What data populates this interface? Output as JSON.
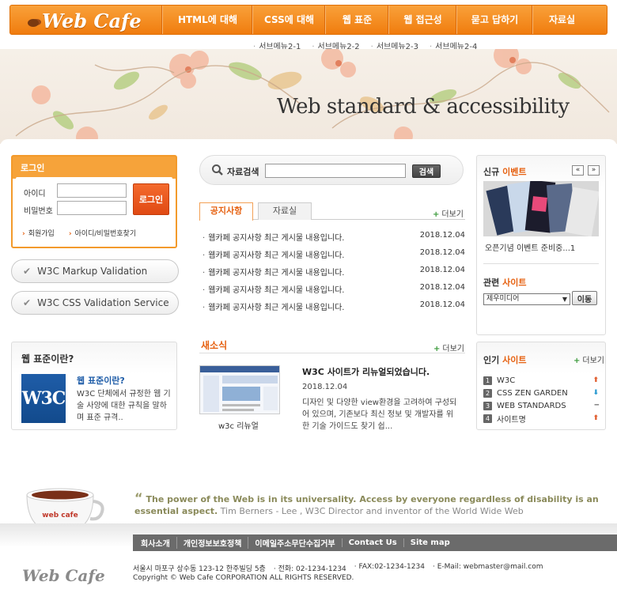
{
  "header": {
    "logo": "Web Cafe",
    "nav": [
      "HTML에 대해",
      "CSS에 대해",
      "웹 표준",
      "웹 접근성",
      "묻고 답하기",
      "자료실"
    ],
    "submenu": [
      "서브메뉴2-1",
      "서브메뉴2-2",
      "서브메뉴2-3",
      "서브메뉴2-4"
    ]
  },
  "banner": {
    "text": "Web standard & accessibility"
  },
  "login": {
    "title": "로그인",
    "id_label": "아이디",
    "pw_label": "비밀번호",
    "button": "로그인",
    "join_link": "회원가입",
    "find_link": "아이디/비밀번호찾기"
  },
  "validation": {
    "markup": "W3C Markup Validation",
    "css": "W3C CSS Validation Service"
  },
  "search": {
    "label": "자료검색",
    "button": "검색"
  },
  "tabs": {
    "notice": "공지사항",
    "archive": "자료실",
    "more": "더보기"
  },
  "notices": [
    {
      "title": "웹카페 공지사항 최근 게시물 내용입니다.",
      "date": "2018.12.04"
    },
    {
      "title": "웹카페 공지사항 최근 게시물 내용입니다.",
      "date": "2018.12.04"
    },
    {
      "title": "웹카페 공지사항 최근 게시물 내용입니다.",
      "date": "2018.12.04"
    },
    {
      "title": "웹카페 공지사항 최근 게시물 내용입니다.",
      "date": "2018.12.04"
    },
    {
      "title": "웹카페 공지사항 최근 게시물 내용입니다.",
      "date": "2018.12.04"
    }
  ],
  "news": {
    "title": "새소식",
    "more": "더보기",
    "thumb_caption": "w3c 리뉴얼",
    "headline": "W3C 사이트가 리뉴얼되었습니다.",
    "date": "2018.12.04",
    "body": "디자인 및 다양한 view환경을 고려하여 구성되어 있으며, 기존보다 최신 정보 및 개발자를 위한 기술 가이드도 찾기 쉽..."
  },
  "w3c": {
    "title": "웹 표준이란?",
    "logo": "W3C",
    "heading": "웹 표준이란?",
    "body": "W3C 단체에서 규정한 웹 기술 사양에 대한 규칙을 말하며 표준 규격.."
  },
  "event": {
    "title_a": "신규 ",
    "title_b": "이벤트",
    "prev": "«",
    "next": "»",
    "caption": "오픈기념 이벤트 준비중...1"
  },
  "related": {
    "title_a": "관련 ",
    "title_b": "사이트",
    "select": "제우미디어",
    "button": "이동"
  },
  "popular": {
    "title_a": "인기 ",
    "title_b": "사이트",
    "more": "더보기",
    "items": [
      {
        "num": "1",
        "name": "W3C",
        "trend": "up",
        "color": "#e05a2a"
      },
      {
        "num": "2",
        "name": "CSS ZEN GARDEN",
        "trend": "down",
        "color": "#2a9ad0"
      },
      {
        "num": "3",
        "name": "WEB STANDARDS",
        "trend": "same",
        "color": "#888888"
      },
      {
        "num": "4",
        "name": "사이트명",
        "trend": "up",
        "color": "#e05a2a"
      }
    ]
  },
  "quote": {
    "line1": "The power of the Web is in its universality. Access by everyone regardless of disability is an essential aspect.",
    "line2": "Tim Berners - Lee , W3C Director and inventor of the World Wide Web"
  },
  "cup": {
    "label": "web cafe"
  },
  "footer": {
    "links": [
      "회사소개",
      "개인정보보호정책",
      "이메일주소무단수집거부",
      "Contact Us",
      "Site map"
    ],
    "logo": "Web Cafe",
    "address": "서울시 마포구 상수동 123-12 한주빌딩 5층",
    "tel": "· 전화: 02-1234-1234",
    "fax": "· FAX:02-1234-1234",
    "email": "· E-Mail: webmaster@mail.com",
    "copyright": "Copyright © Web Cafe CORPORATION ALL RIGHTS RESERVED."
  },
  "colors": {
    "accent": "#f07c0e",
    "highlight": "#e6600f",
    "footer_nav": "#6b6b6b",
    "w3c_blue": "#1f5da8"
  }
}
